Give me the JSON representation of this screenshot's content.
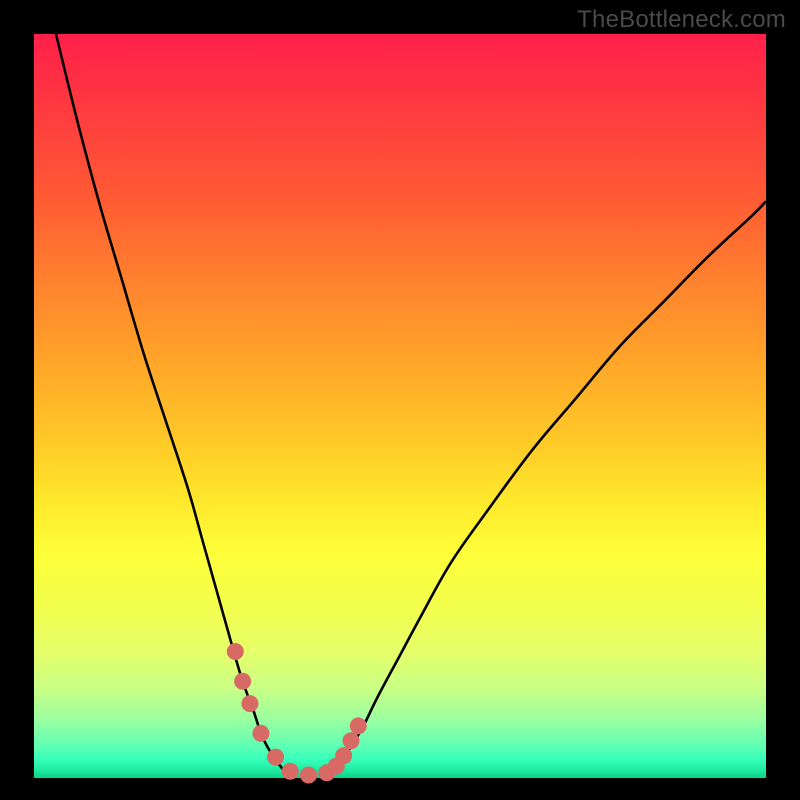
{
  "watermark": "TheBottleneck.com",
  "colors": {
    "frame": "#000000",
    "curve": "#000000",
    "marker": "#d86a65"
  },
  "chart_data": {
    "type": "line",
    "title": "",
    "xlabel": "",
    "ylabel": "",
    "xlim": [
      0,
      100
    ],
    "ylim": [
      0,
      100
    ],
    "grid": false,
    "legend": false,
    "series": [
      {
        "name": "left-curve",
        "x": [
          3,
          6,
          9,
          12,
          15,
          18,
          21,
          23,
          25,
          27,
          28.5,
          30,
          31,
          32,
          33,
          34,
          35
        ],
        "values": [
          100,
          88,
          77,
          67,
          57,
          48,
          39,
          32,
          25,
          18,
          13,
          9,
          6,
          4,
          2.5,
          1.2,
          0.6
        ]
      },
      {
        "name": "right-curve",
        "x": [
          40,
          41,
          42,
          43.5,
          45,
          47,
          50,
          53,
          57,
          62,
          68,
          74,
          80,
          86,
          92,
          98,
          100
        ],
        "values": [
          0.6,
          1.2,
          2.4,
          4.5,
          7,
          11,
          16.5,
          22,
          29,
          36,
          44,
          51,
          58,
          64,
          70,
          75.5,
          77.5
        ]
      }
    ],
    "markers": {
      "name": "highlight-points",
      "x": [
        27.5,
        28.5,
        29.5,
        31,
        33,
        35,
        37.5,
        40,
        41.3,
        42.3,
        43.3,
        44.3
      ],
      "values": [
        17,
        13,
        10,
        6,
        2.8,
        0.9,
        0.4,
        0.7,
        1.6,
        3,
        5,
        7
      ]
    }
  }
}
